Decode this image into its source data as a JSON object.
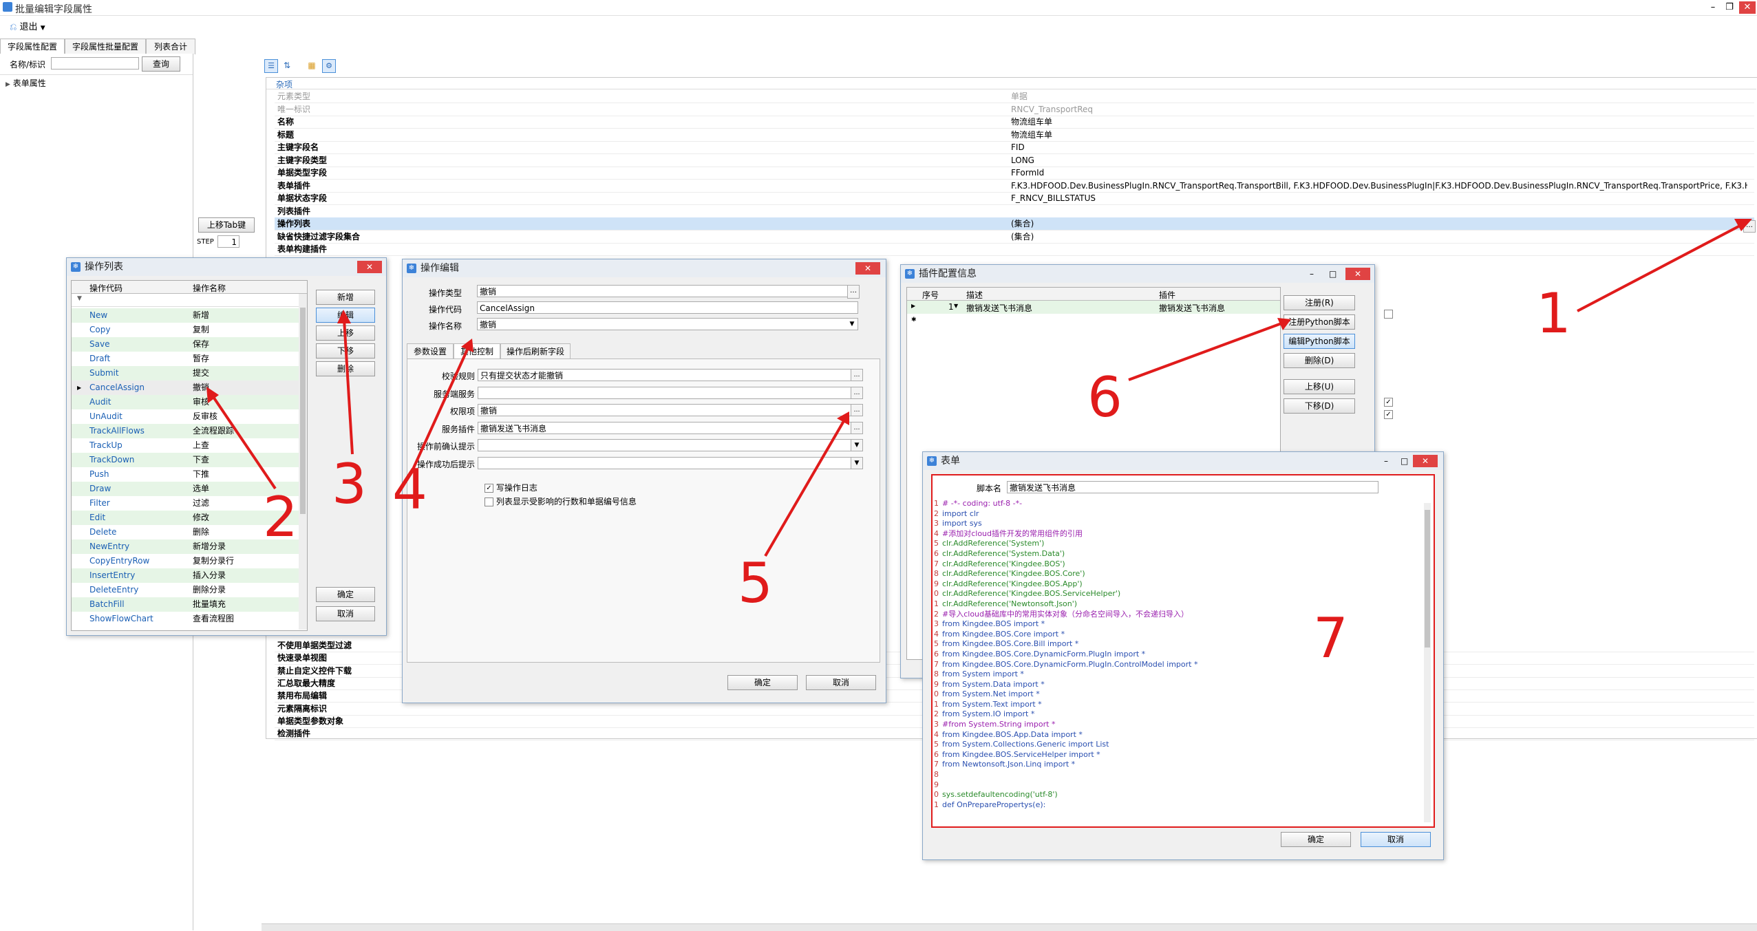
{
  "window": {
    "title": "批量编辑字段属性"
  },
  "toolbar": {
    "exit_label": "退出"
  },
  "tabs": [
    {
      "label": "字段属性配置"
    },
    {
      "label": "字段属性批量配置"
    },
    {
      "label": "列表合计"
    }
  ],
  "search": {
    "label": "名称/标识",
    "button": "查询"
  },
  "tree": {
    "root": "表单属性"
  },
  "left_buttons": {
    "move_tab": "上移Tab键",
    "step_label": "STEP",
    "step_value": "1"
  },
  "propgrid": {
    "category": "杂项",
    "rows": [
      {
        "name": "元素类型",
        "value": "单据"
      },
      {
        "name": "唯一标识",
        "value": "RNCV_TransportReq"
      },
      {
        "name": "名称",
        "value": "物流组车单"
      },
      {
        "name": "标题",
        "value": "物流组车单"
      },
      {
        "name": "主键字段名",
        "value": "FID"
      },
      {
        "name": "主键字段类型",
        "value": "LONG"
      },
      {
        "name": "单据类型字段",
        "value": "FFormId"
      },
      {
        "name": "表单插件",
        "value": "F.K3.HDFOOD.Dev.BusinessPlugIn.RNCV_TransportReq.TransportBill, F.K3.HDFOOD.Dev.BusinessPlugIn|F.K3.HDFOOD.Dev.BusinessPlugIn.RNCV_TransportReq.TransportPrice, F.K3.HDFOOD.Dev..."
      },
      {
        "name": "单据状态字段",
        "value": "F_RNCV_BILLSTATUS"
      },
      {
        "name": "列表插件",
        "value": ""
      },
      {
        "name": "操作列表",
        "value": "(集合)"
      },
      {
        "name": "缺省快捷过滤字段集合",
        "value": "(集合)"
      },
      {
        "name": "表单构建插件",
        "value": ""
      }
    ],
    "lower_rows": [
      {
        "name": "不使用单据类型过滤"
      },
      {
        "name": "快速录单视图"
      },
      {
        "name": "禁止自定义控件下载"
      },
      {
        "name": "汇总取最大精度"
      },
      {
        "name": "禁用布局编辑"
      },
      {
        "name": "元素隔离标识"
      },
      {
        "name": "单据类型参数对象"
      },
      {
        "name": "检测插件"
      }
    ]
  },
  "op_list": {
    "title": "操作列表",
    "col_code": "操作代码",
    "col_name": "操作名称",
    "rows": [
      {
        "code": "New",
        "name": "新增"
      },
      {
        "code": "Copy",
        "name": "复制"
      },
      {
        "code": "Save",
        "name": "保存"
      },
      {
        "code": "Draft",
        "name": "暂存"
      },
      {
        "code": "Submit",
        "name": "提交"
      },
      {
        "code": "CancelAssign",
        "name": "撤销"
      },
      {
        "code": "Audit",
        "name": "审核"
      },
      {
        "code": "UnAudit",
        "name": "反审核"
      },
      {
        "code": "TrackAllFlows",
        "name": "全流程跟踪"
      },
      {
        "code": "TrackUp",
        "name": "上查"
      },
      {
        "code": "TrackDown",
        "name": "下查"
      },
      {
        "code": "Push",
        "name": "下推"
      },
      {
        "code": "Draw",
        "name": "选单"
      },
      {
        "code": "Filter",
        "name": "过滤"
      },
      {
        "code": "Edit",
        "name": "修改"
      },
      {
        "code": "Delete",
        "name": "删除"
      },
      {
        "code": "NewEntry",
        "name": "新增分录"
      },
      {
        "code": "CopyEntryRow",
        "name": "复制分录行"
      },
      {
        "code": "InsertEntry",
        "name": "插入分录"
      },
      {
        "code": "DeleteEntry",
        "name": "删除分录"
      },
      {
        "code": "BatchFill",
        "name": "批量填充"
      },
      {
        "code": "ShowFlowChart",
        "name": "查看流程图"
      }
    ],
    "buttons": {
      "add": "新增",
      "edit": "编辑",
      "up": "上移",
      "down": "下移",
      "delete": "删除",
      "ok": "确定",
      "cancel": "取消"
    }
  },
  "op_edit": {
    "title": "操作编辑",
    "type_label": "操作类型",
    "type_value": "撤销",
    "code_label": "操作代码",
    "code_value": "CancelAssign",
    "name_label": "操作名称",
    "name_value": "撤销",
    "tabs": [
      {
        "label": "参数设置"
      },
      {
        "label": "其他控制"
      },
      {
        "label": "操作后刷新字段"
      }
    ],
    "fields": [
      {
        "label": "校验规则",
        "value": "只有提交状态才能撤销"
      },
      {
        "label": "服务端服务",
        "value": ""
      },
      {
        "label": "权限项",
        "value": "撤销"
      },
      {
        "label": "服务插件",
        "value": "撤销发送飞书消息"
      },
      {
        "label": "操作前确认提示",
        "value": ""
      },
      {
        "label": "操作成功后提示",
        "value": ""
      }
    ],
    "check_log": "写操作日志",
    "check_list": "列表显示受影响的行数和单据编号信息",
    "ok": "确定",
    "cancel": "取消"
  },
  "plugin_cfg": {
    "title": "插件配置信息",
    "cols": [
      "序号",
      "描述",
      "插件"
    ],
    "row": {
      "seq": "1",
      "desc": "撤销发送飞书消息",
      "plugin": "撤销发送飞书消息"
    },
    "buttons": {
      "register": "注册(R)",
      "register_py": "注册Python脚本",
      "edit_py": "编辑Python脚本",
      "delete": "删除(D)",
      "up": "上移(U)",
      "down": "下移(D)"
    }
  },
  "script_form": {
    "title": "表单",
    "name_label": "脚本名",
    "name_value": "撤销发送飞书消息",
    "ok": "确定",
    "cancel": "取消",
    "code_lines": [
      "# -*- coding: utf-8 -*-",
      "import clr",
      "import sys",
      "#添加对cloud插件开发的常用组件的引用",
      "clr.AddReference('System')",
      "clr.AddReference('System.Data')",
      "clr.AddReference('Kingdee.BOS')",
      "clr.AddReference('Kingdee.BOS.Core')",
      "clr.AddReference('Kingdee.BOS.App')",
      "clr.AddReference('Kingdee.BOS.ServiceHelper')",
      "clr.AddReference('Newtonsoft.Json')",
      "#导入cloud基础库中的常用实体对象（分命名空间导入，不会递归导入）",
      "from Kingdee.BOS import *",
      "from Kingdee.BOS.Core import *",
      "from Kingdee.BOS.Core.Bill import *",
      "from Kingdee.BOS.Core.DynamicForm.PlugIn import *",
      "from Kingdee.BOS.Core.DynamicForm.PlugIn.ControlModel import *",
      "from System import *",
      "from System.Data import *",
      "from System.Net import *",
      "from System.Text import *",
      "from System.IO import *",
      "#from System.String import *",
      "from Kingdee.BOS.App.Data import *",
      "from System.Collections.Generic import List",
      "from Kingdee.BOS.ServiceHelper import *",
      "from Newtonsoft.Json.Linq import *",
      "",
      "",
      "sys.setdefaultencoding('utf-8')",
      "def OnPreparePropertys(e):"
    ]
  },
  "annotations": [
    "1",
    "2",
    "3",
    "4",
    "5",
    "6",
    "7"
  ],
  "colors": {
    "annotation": "#e01b1b",
    "accent": "#3c82d8",
    "row_alt": "#e6f5e6"
  }
}
